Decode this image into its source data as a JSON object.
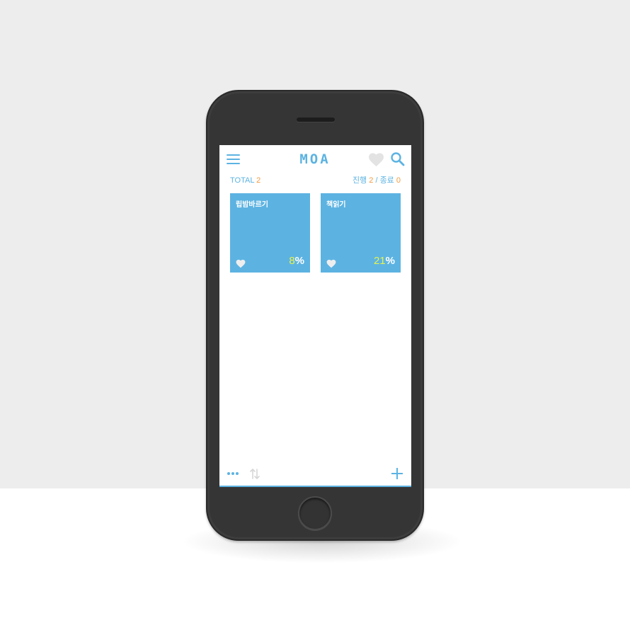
{
  "app": {
    "logo": "MOA"
  },
  "header": {
    "menu_icon": "hamburger-menu-icon",
    "favorites_icon": "heart-icon",
    "search_icon": "search-icon"
  },
  "stats": {
    "total_label": "TOTAL",
    "total_value": "2",
    "in_progress_label": "진행",
    "in_progress_value": "2",
    "separator": "/",
    "finished_label": "종료",
    "finished_value": "0"
  },
  "cards": [
    {
      "title": "립밤바르기",
      "percent_value": "8",
      "percent_sign": "%",
      "progress": 0.08
    },
    {
      "title": "책읽기",
      "percent_value": "21",
      "percent_sign": "%",
      "progress": 0.21
    }
  ],
  "bottom_bar": {
    "more_icon": "more-dots-icon",
    "sort_icon": "sort-arrows-icon",
    "add_icon": "plus-icon"
  },
  "colors": {
    "accent": "#5cb3e2",
    "count_orange": "#f29b41",
    "percent_yellow": "#e8f24b",
    "phone_body": "#353535",
    "background_top": "#ededed"
  }
}
